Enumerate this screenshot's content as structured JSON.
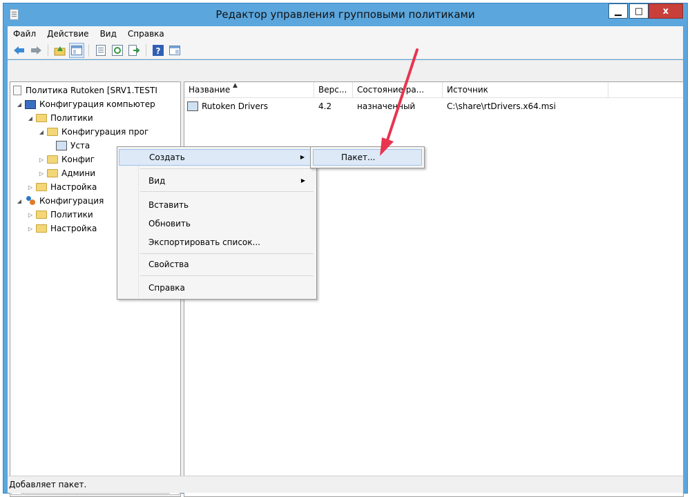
{
  "window": {
    "title": "Редактор управления групповыми политиками"
  },
  "menubar": {
    "items": [
      "Файл",
      "Действие",
      "Вид",
      "Справка"
    ]
  },
  "toolbar": {
    "icons": [
      "back-icon",
      "forward-icon",
      "up-folder-icon",
      "show-hide-tree-icon",
      "properties-icon",
      "refresh-icon",
      "export-list-icon",
      "help-icon",
      "show-action-pane-icon"
    ]
  },
  "tree": {
    "items": [
      {
        "label": "Политика Rutoken [SRV1.TESTI"
      },
      {
        "label": "Конфигурация компьютер"
      },
      {
        "label": "Политики"
      },
      {
        "label": "Конфигурация прог"
      },
      {
        "label": "Уста"
      },
      {
        "label": "Конфиг"
      },
      {
        "label": "Админи"
      },
      {
        "label": "Настройка"
      },
      {
        "label": "Конфигурация"
      },
      {
        "label": "Политики"
      },
      {
        "label": "Настройка"
      }
    ],
    "scroll_thumb_label": "III"
  },
  "list": {
    "columns": [
      "Название",
      "Верс...",
      "Состояние ра...",
      "Источник"
    ],
    "rows": [
      {
        "name": "Rutoken Drivers",
        "version": "4.2",
        "state": "назначенный",
        "source": "C:\\share\\rtDrivers.x64.msi"
      }
    ]
  },
  "context_menu": {
    "items": [
      "Создать",
      "Вид",
      "Вставить",
      "Обновить",
      "Экспортировать список...",
      "Свойства",
      "Справка"
    ]
  },
  "submenu": {
    "items": [
      "Пакет..."
    ]
  },
  "status_bar": {
    "text": "Добавляет пакет."
  },
  "colors": {
    "titlebar": "#5ba6dd",
    "close_button": "#c9403a",
    "menu_highlight": "#dde9f7",
    "annotation_arrow": "#e8344e"
  }
}
